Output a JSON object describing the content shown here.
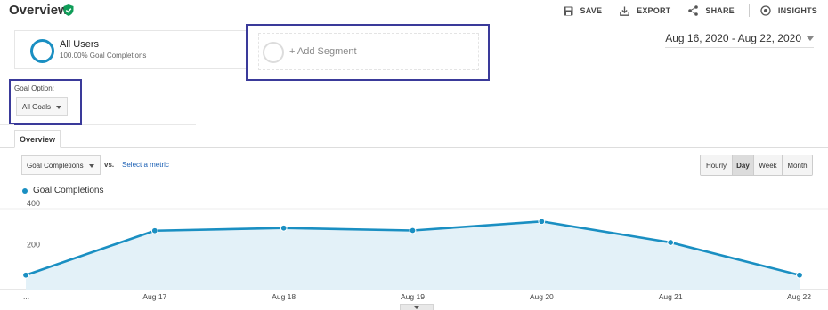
{
  "header": {
    "title": "Overview",
    "actions": [
      {
        "label": "SAVE",
        "icon": "save-icon"
      },
      {
        "label": "EXPORT",
        "icon": "export-icon"
      },
      {
        "label": "SHARE",
        "icon": "share-icon"
      },
      {
        "label": "INSIGHTS",
        "icon": "insights-icon"
      }
    ]
  },
  "segments": {
    "active": {
      "name": "All Users",
      "detail": "100.00% Goal Completions"
    },
    "add_label": "+ Add Segment"
  },
  "date_range": "Aug 16, 2020 - Aug 22, 2020",
  "goal_option": {
    "label": "Goal Option:",
    "selected": "All Goals"
  },
  "tabs": [
    {
      "label": "Overview",
      "active": true
    }
  ],
  "metric": {
    "selected": "Goal Completions",
    "vs_label": "vs.",
    "select_metric_label": "Select a metric"
  },
  "period_buttons": [
    {
      "label": "Hourly",
      "active": false
    },
    {
      "label": "Day",
      "active": true
    },
    {
      "label": "Week",
      "active": false
    },
    {
      "label": "Month",
      "active": false
    }
  ],
  "legend_label": "Goal Completions",
  "colors": {
    "accent": "#1a8fc2",
    "area": "#e3f1f8",
    "highlight_border": "#3a3a9a",
    "verified": "#0f9d58"
  },
  "chart_data": {
    "type": "area",
    "series": [
      {
        "name": "Goal Completions",
        "values": [
          70,
          285,
          298,
          286,
          330,
          228,
          70
        ]
      }
    ],
    "x": [
      "...",
      "Aug 17",
      "Aug 18",
      "Aug 19",
      "Aug 20",
      "Aug 21",
      "Aug 22"
    ],
    "y_ticks": [
      "400",
      "200"
    ],
    "ylim": [
      0,
      400
    ],
    "grid": true
  }
}
